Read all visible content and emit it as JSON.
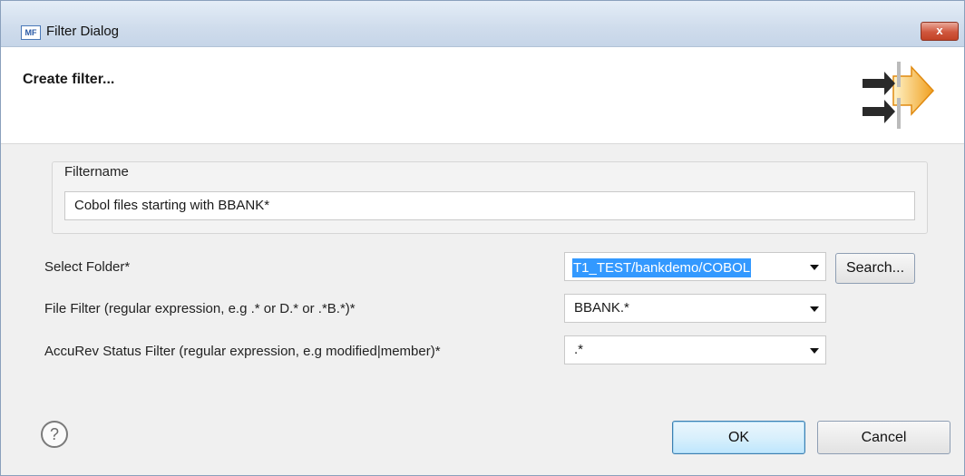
{
  "window": {
    "title": "Filter Dialog",
    "app_icon_text": "MF",
    "close_glyph": "x"
  },
  "header": {
    "title": "Create filter...",
    "wizard_icon": "filter-wizard-arrows-icon"
  },
  "filtername": {
    "label": "Filtername",
    "value": "Cobol files starting with BBANK*"
  },
  "folder": {
    "label": "Select Folder*",
    "value": "T1_TEST/bankdemo/COBOL",
    "search_label": "Search..."
  },
  "file_filter": {
    "label": "File Filter (regular expression, e.g .* or D.* or .*B.*)*",
    "value": "BBANK.*"
  },
  "status_filter": {
    "label": "AccuRev Status Filter (regular expression, e.g modified|member)*",
    "value": ".*"
  },
  "footer": {
    "help_glyph": "?",
    "ok_label": "OK",
    "cancel_label": "Cancel"
  },
  "colors": {
    "selection": "#3399ff",
    "close_button": "#c24326",
    "default_button_border": "#3c7fb1",
    "wizard_orange": "#f0a020",
    "wizard_arrow": "#2a2a2a"
  }
}
